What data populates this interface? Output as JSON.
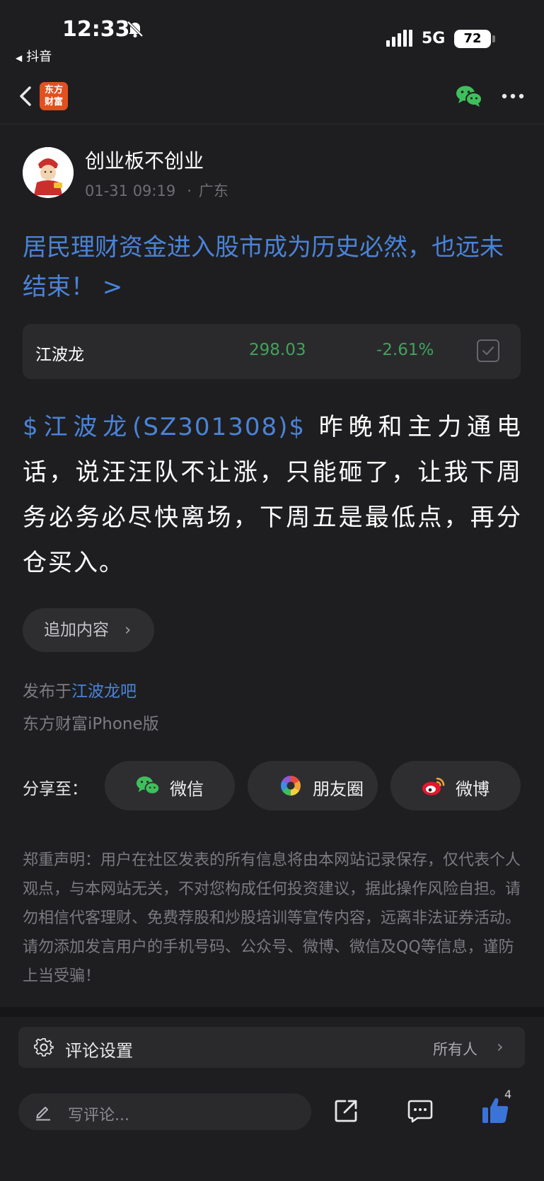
{
  "status_bar": {
    "time": "12:33",
    "back_app": "抖音",
    "network": "5G",
    "battery": "72"
  },
  "nav": {
    "logo_line1": "东方",
    "logo_line2": "财富"
  },
  "author": {
    "name": "创业板不创业",
    "time": "01-31 09:19",
    "location": "广东"
  },
  "post": {
    "title": "居民理财资金进入股市成为历史必然，也远未结束！ >",
    "body_tag": "$江波龙(SZ301308)$",
    "body_text": " 昨晚和主力通电话，说汪汪队不让涨，只能砸了，让我下周务必务必尽快离场，下周五是最低点，再分仓买入。",
    "append_label": "追加内容",
    "published_prefix": "发布于",
    "published_bar": "江波龙吧",
    "source": "东方财富iPhone版"
  },
  "stock": {
    "name": "江波龙",
    "price": "298.03",
    "change": "-2.61%",
    "color": "#41a35a"
  },
  "share": {
    "label": "分享至：",
    "wechat": "微信",
    "moments": "朋友圈",
    "weibo": "微博"
  },
  "disclaimer": "郑重声明：用户在社区发表的所有信息将由本网站记录保存，仅代表个人观点，与本网站无关，不对您构成任何投资建议，据此操作风险自担。请勿相信代客理财、免费荐股和炒股培训等宣传内容，远离非法证券活动。请勿添加发言用户的手机号码、公众号、微博、微信及QQ等信息，谨防上当受骗！",
  "comment_settings": {
    "label": "评论设置",
    "value": "所有人"
  },
  "bottom_bar": {
    "placeholder": "写评论...",
    "like_count": "4"
  },
  "colors": {
    "accent_blue": "#4a83d8",
    "stock_green": "#41a35a",
    "brand_orange": "#e25020"
  }
}
